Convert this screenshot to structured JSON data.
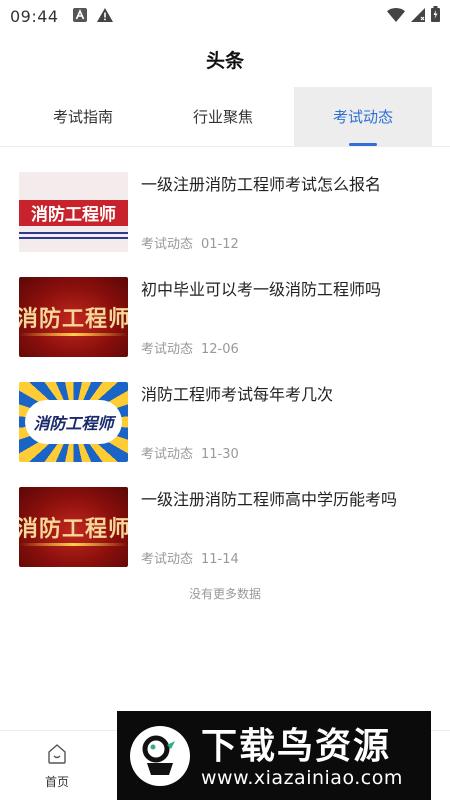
{
  "status_bar": {
    "time": "09:44",
    "left_icons": [
      "font-a-icon",
      "warning-icon"
    ],
    "right_icons": [
      "wifi-icon",
      "signal-icon",
      "battery-icon"
    ]
  },
  "header": {
    "title": "头条"
  },
  "tabs": [
    {
      "label": "考试指南",
      "active": false
    },
    {
      "label": "行业聚焦",
      "active": false
    },
    {
      "label": "考试动态",
      "active": true
    }
  ],
  "news": [
    {
      "title": "一级注册消防工程师考试怎么报名",
      "category": "考试动态",
      "date": "01-12",
      "thumb_text": "消防工程师"
    },
    {
      "title": "初中毕业可以考一级消防工程师吗",
      "category": "考试动态",
      "date": "12-06",
      "thumb_text": "消防工程师"
    },
    {
      "title": "消防工程师考试每年考几次",
      "category": "考试动态",
      "date": "11-30",
      "thumb_text": "消防工程师"
    },
    {
      "title": "一级注册消防工程师高中学历能考吗",
      "category": "考试动态",
      "date": "11-14",
      "thumb_text": "消防工程师"
    }
  ],
  "footer_text": "没有更多数据",
  "bottom_nav": {
    "home_label": "首页"
  },
  "watermark": {
    "title": "下载鸟资源",
    "url": "www.xiazainiao.com"
  },
  "colors": {
    "accent": "#2f6fd6",
    "tab_active_bg": "#ededed",
    "meta_gray": "#999999"
  }
}
